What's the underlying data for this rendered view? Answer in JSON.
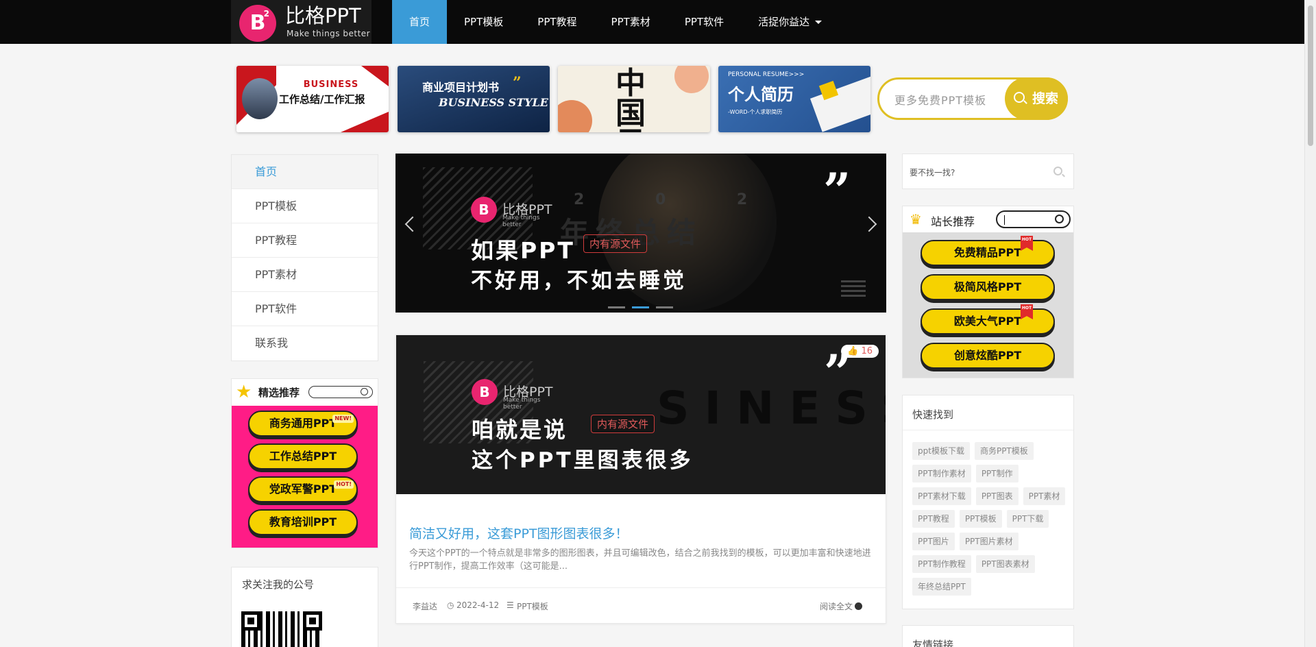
{
  "brand": {
    "name": "比格PPT",
    "slogan": "Make things better",
    "badge": "B",
    "badge_sup": "2"
  },
  "nav": [
    {
      "label": "首页",
      "active": true
    },
    {
      "label": "PPT模板"
    },
    {
      "label": "PPT教程"
    },
    {
      "label": "PPT素材"
    },
    {
      "label": "PPT软件"
    },
    {
      "label": "活捉你益达",
      "dropdown": true
    }
  ],
  "thumbs": {
    "t1": {
      "big": "BUSINESS",
      "title": "工作总结/工作汇报"
    },
    "t2": {
      "cn": "商业项目计划书",
      "en": "BUSINESS STYLE",
      "quote": "”"
    },
    "t3": {
      "ink": "中国风"
    },
    "t4": {
      "small": "PERSONAL RESUME>>>",
      "cn": "个人简历",
      "sub": "-WORD-个人求职简历"
    }
  },
  "top_search": {
    "placeholder": "更多免费PPT模板",
    "button": "搜索"
  },
  "left_menu": [
    {
      "label": "首页",
      "active": true
    },
    {
      "label": "PPT模板"
    },
    {
      "label": "PPT教程"
    },
    {
      "label": "PPT素材"
    },
    {
      "label": "PPT软件"
    },
    {
      "label": "联系我"
    }
  ],
  "featured": {
    "title": "精选推荐",
    "buttons": [
      {
        "label": "商务通用PPT",
        "tag": "NEW!"
      },
      {
        "label": "工作总结PPT"
      },
      {
        "label": "党政军警PPT",
        "tag": "HOT!"
      },
      {
        "label": "教育培训PPT"
      }
    ]
  },
  "follow": {
    "title": "求关注我的公号"
  },
  "hero": {
    "brand": "比格PPT",
    "brand_sub": "Make things better",
    "ghost_num": "2 0 2",
    "ghost_text": "年终总结",
    "line1": "如果PPT",
    "line2": "不好用，不如去睡觉",
    "badge": "内有源文件",
    "quote": "”",
    "slides": 3,
    "active_slide": 2
  },
  "post": {
    "likes": "16",
    "brand": "比格PPT",
    "brand_sub": "Make things better",
    "ghost_text": "SINESS",
    "line1": "咱就是说",
    "line2": "这个PPT里图表很多",
    "badge": "内有源文件",
    "quote": "”",
    "title": "简洁又好用，这套PPT图形图表很多！",
    "desc": "今天这个PPT的一个特点就是非常多的图形图表，并且可编辑改色，结合之前我找到的模板，可以更加丰富和快速地进行PPT制作，提高工作效率（这可能是...",
    "author": "李益达",
    "date": "2022-4-12",
    "category": "PPT模板",
    "read_more": "阅读全文"
  },
  "right_search": {
    "placeholder": "要不找一找?"
  },
  "admin": {
    "title": "站长推荐",
    "buttons": [
      {
        "label": "免费精品PPT",
        "hot": true
      },
      {
        "label": "极简风格PPT"
      },
      {
        "label": "欧美大气PPT",
        "hot": true
      },
      {
        "label": "创意炫酷PPT"
      }
    ],
    "hot_label": "HOT"
  },
  "quick": {
    "title": "快速找到",
    "tags": [
      "ppt模板下载",
      "商务PPT模板",
      "PPT制作素材",
      "PPT制作",
      "PPT素材下载",
      "PPT图表",
      "PPT素材",
      "PPT教程",
      "PPT模板",
      "PPT下载",
      "PPT图片",
      "PPT图片素材",
      "PPT制作教程",
      "PPT图表素材",
      "年终总结PPT"
    ]
  },
  "links": {
    "title": "友情链接"
  },
  "colors": {
    "accent": "#3a9bd7",
    "brand_pink": "#e8256f",
    "yellow": "#f6d200",
    "gold": "#dfbf23",
    "featured_bg": "#ff1c86"
  }
}
